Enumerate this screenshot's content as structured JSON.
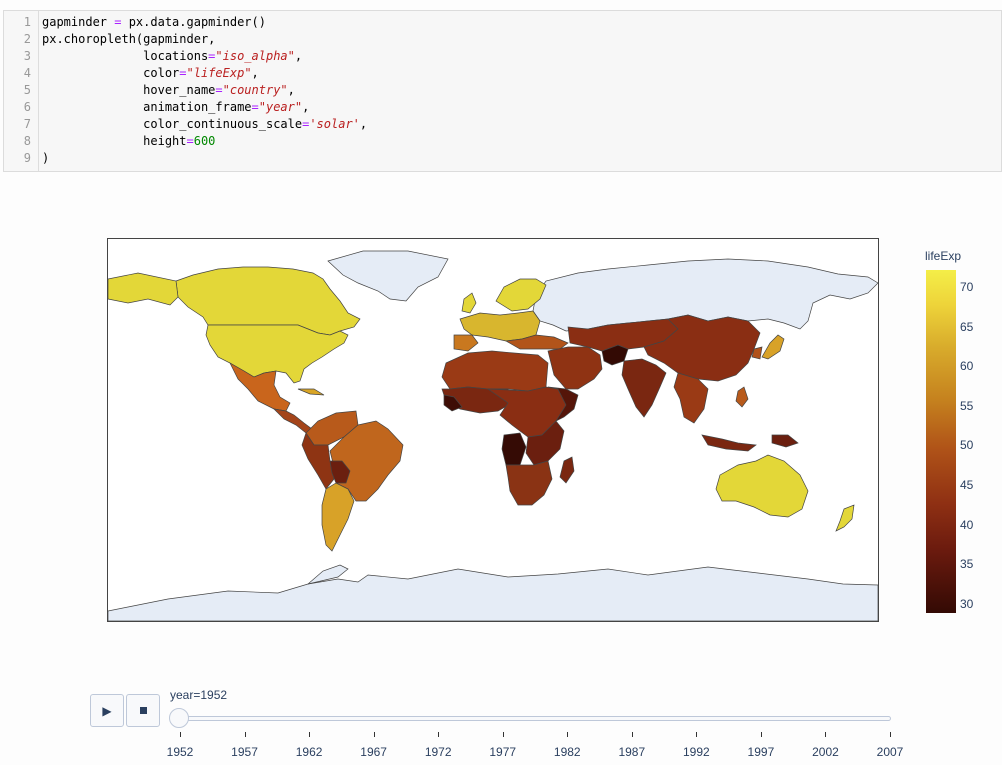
{
  "code": {
    "line_numbers": [
      "1",
      "2",
      "3",
      "4",
      "5",
      "6",
      "7",
      "8",
      "9"
    ],
    "lines": [
      [
        {
          "t": "gapminder ",
          "c": ""
        },
        {
          "t": "=",
          "c": "op"
        },
        {
          "t": " px.data.gapminder()",
          "c": ""
        }
      ],
      [
        {
          "t": "px.choropleth(gapminder,",
          "c": ""
        }
      ],
      [
        {
          "t": "              locations",
          "c": ""
        },
        {
          "t": "=",
          "c": "op"
        },
        {
          "t": "\"iso_alpha\"",
          "c": "str"
        },
        {
          "t": ",",
          "c": ""
        }
      ],
      [
        {
          "t": "              color",
          "c": ""
        },
        {
          "t": "=",
          "c": "op"
        },
        {
          "t": "\"lifeExp\"",
          "c": "str"
        },
        {
          "t": ",",
          "c": ""
        }
      ],
      [
        {
          "t": "              hover_name",
          "c": ""
        },
        {
          "t": "=",
          "c": "op"
        },
        {
          "t": "\"country\"",
          "c": "str"
        },
        {
          "t": ",",
          "c": ""
        }
      ],
      [
        {
          "t": "              animation_frame",
          "c": ""
        },
        {
          "t": "=",
          "c": "op"
        },
        {
          "t": "\"year\"",
          "c": "str"
        },
        {
          "t": ",",
          "c": ""
        }
      ],
      [
        {
          "t": "              color_continuous_scale",
          "c": ""
        },
        {
          "t": "=",
          "c": "op"
        },
        {
          "t": "'solar'",
          "c": "str"
        },
        {
          "t": ",",
          "c": ""
        }
      ],
      [
        {
          "t": "              height",
          "c": ""
        },
        {
          "t": "=",
          "c": "op"
        },
        {
          "t": "600",
          "c": "num"
        }
      ],
      [
        {
          "t": ")",
          "c": ""
        }
      ]
    ]
  },
  "map": {
    "ocean_color": "#ffffff",
    "no_data_color": "#e5ecf6",
    "border_color": "#444444"
  },
  "colorbar": {
    "title": "lifeExp",
    "ticks": [
      "70",
      "65",
      "60",
      "55",
      "50",
      "45",
      "40",
      "35",
      "30"
    ]
  },
  "slider": {
    "current_label": "year=1952",
    "years": [
      "1952",
      "1957",
      "1962",
      "1967",
      "1972",
      "1977",
      "1982",
      "1987",
      "1992",
      "1997",
      "2002",
      "2007"
    ],
    "play_icon": "play-icon",
    "stop_icon": "stop-icon"
  }
}
